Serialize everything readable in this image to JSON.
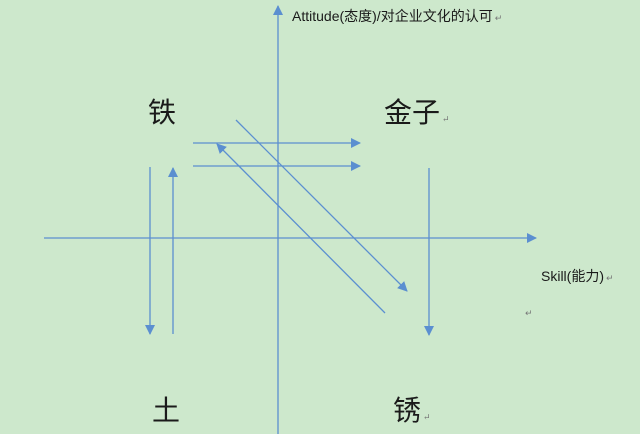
{
  "axes": {
    "y_label": "Attitude(态度)/对企业文化的认可",
    "x_label": "Skill(能力)"
  },
  "quadrants": {
    "top_left": "铁",
    "top_right": "金子",
    "bottom_left": "土",
    "bottom_right": "锈"
  },
  "paragraph_mark": "↵",
  "colors": {
    "background": "#cde8cc",
    "line": "#5b8fd0",
    "text": "#1a1a1a"
  }
}
